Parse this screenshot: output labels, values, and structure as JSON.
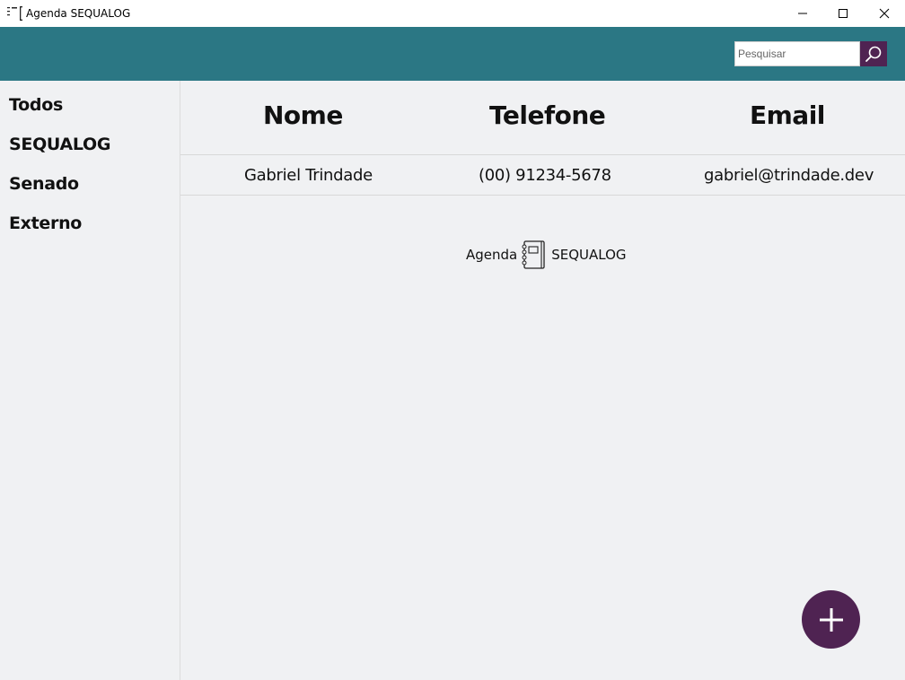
{
  "window": {
    "title": "Agenda SEQUALOG",
    "minimize_icon": "minimize-icon",
    "maximize_icon": "maximize-icon",
    "close_icon": "close-icon"
  },
  "header": {
    "background_color": "#2b7784",
    "search": {
      "placeholder": "Pesquisar",
      "value": "",
      "button_icon": "search-icon",
      "button_color": "#4f2352"
    }
  },
  "sidebar": {
    "items": [
      {
        "label": "Todos"
      },
      {
        "label": "SEQUALOG"
      },
      {
        "label": "Senado"
      },
      {
        "label": "Externo"
      }
    ]
  },
  "table": {
    "columns": [
      "Nome",
      "Telefone",
      "Email"
    ],
    "rows": [
      {
        "nome": "Gabriel Trindade",
        "telefone": "(00) 91234-5678",
        "email": "gabriel@trindade.dev"
      }
    ]
  },
  "brand": {
    "left": "Agenda",
    "right": "SEQUALOG",
    "icon": "notebook-icon"
  },
  "fab": {
    "icon": "plus-icon",
    "color": "#4f2352"
  }
}
